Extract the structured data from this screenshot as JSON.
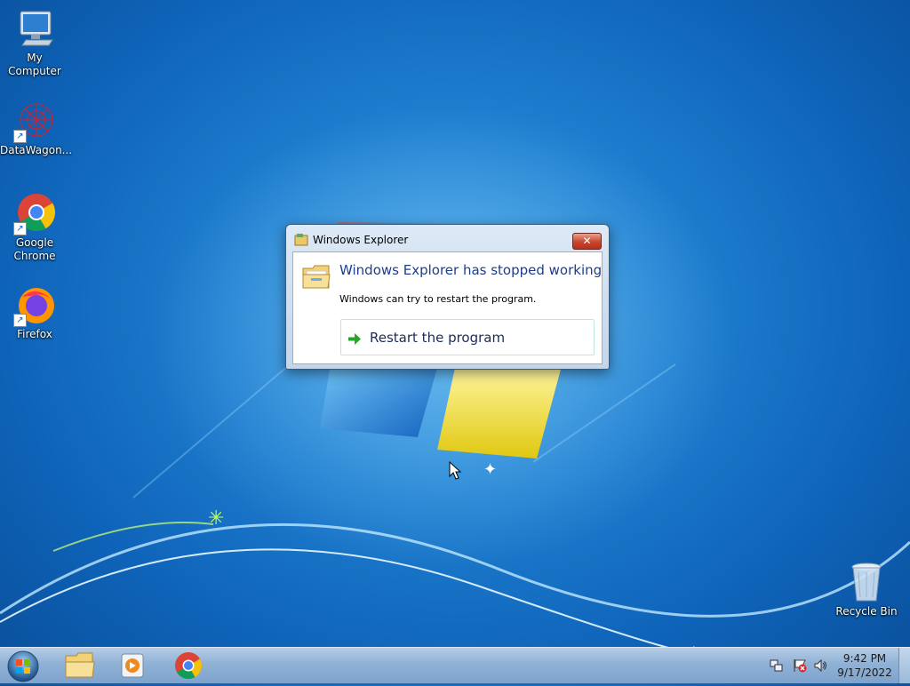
{
  "desktop": {
    "icons": [
      {
        "label": "My Computer",
        "icon": "computer-icon"
      },
      {
        "label": "DataWagon...",
        "icon": "datawagon-icon"
      },
      {
        "label": "Google Chrome",
        "icon": "chrome-icon"
      },
      {
        "label": "Firefox",
        "icon": "firefox-icon"
      },
      {
        "label": "Recycle Bin",
        "icon": "recycle-bin-icon"
      }
    ]
  },
  "dialog": {
    "title": "Windows Explorer",
    "close_label": "✕",
    "heading": "Windows Explorer has stopped working",
    "message": "Windows can try to restart the program.",
    "restart_label": "Restart the program"
  },
  "taskbar": {
    "start_icon": "windows-start-icon",
    "pinned": [
      "explorer-folder-icon",
      "media-player-icon",
      "chrome-icon"
    ],
    "tray": [
      "network-icon",
      "action-center-icon",
      "volume-icon"
    ],
    "time": "9:42 PM",
    "date": "9/17/2022"
  },
  "colors": {
    "wallpaper_blue": "#1f7fd0",
    "heading_blue": "#1e3e8c",
    "close_red": "#c8452e",
    "taskbar": "#8fb1d6"
  }
}
